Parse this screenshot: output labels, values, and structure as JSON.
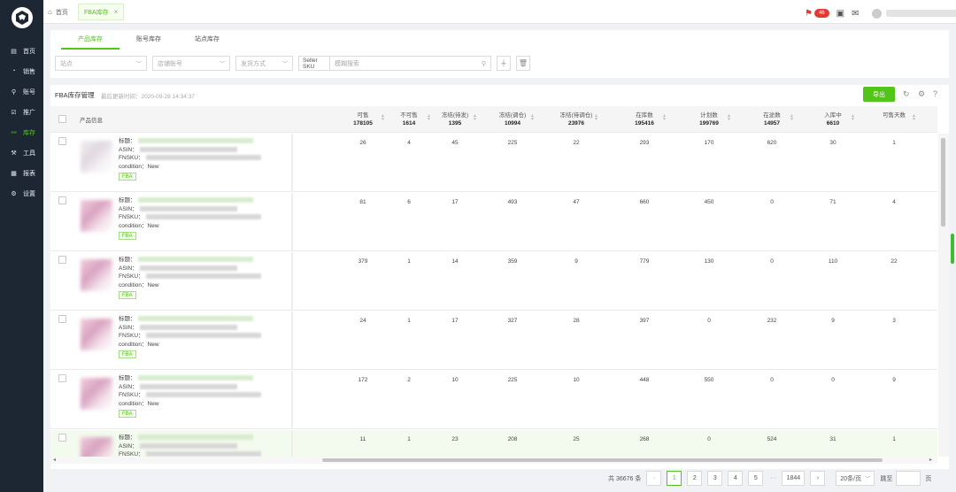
{
  "sidebar": {
    "items": [
      {
        "icon": "▤",
        "label": "首页"
      },
      {
        "icon": "◔",
        "label": "销售"
      },
      {
        "icon": "⚲",
        "label": "账号"
      },
      {
        "icon": "☑",
        "label": "推广"
      },
      {
        "icon": "⚯",
        "label": "库存",
        "active": true
      },
      {
        "icon": "⚒",
        "label": "工具"
      },
      {
        "icon": "▦",
        "label": "报表"
      },
      {
        "icon": "⚙",
        "label": "设置"
      }
    ]
  },
  "topbar": {
    "home_tab": "首页",
    "active_tab": "FBA库存",
    "notification_count": "46"
  },
  "subtabs": [
    "产品库存",
    "账号库存",
    "站点库存"
  ],
  "filters": {
    "site": "站点",
    "store": "店铺账号",
    "ship_method": "发货方式",
    "sku_type": "Seller SKU",
    "search_placeholder": "模糊搜索"
  },
  "panel": {
    "title": "FBA库存管理",
    "updated": "最后更新时间：2020-09-28 14:34:37",
    "export_label": "导出"
  },
  "table": {
    "info_header": "产品信息",
    "columns": [
      {
        "label": "可售",
        "total": "178105"
      },
      {
        "label": "不可售",
        "total": "1614"
      },
      {
        "label": "冻结(待发)",
        "total": "1395"
      },
      {
        "label": "冻结(调仓)",
        "total": "10994"
      },
      {
        "label": "冻结(待调仓)",
        "total": "23976"
      },
      {
        "label": "在库数",
        "total": "195416"
      },
      {
        "label": "计划数",
        "total": "199769"
      },
      {
        "label": "在途数",
        "total": "14957"
      },
      {
        "label": "入库中",
        "total": "6610"
      },
      {
        "label": "可售天数",
        "total": ""
      }
    ],
    "field_labels": {
      "title": "标题：",
      "asin": "ASIN：",
      "fnsku": "FNSKU：",
      "condition": "condition：New",
      "tag": "FBA"
    },
    "rows": [
      {
        "values": [
          "26",
          "4",
          "45",
          "225",
          "22",
          "293",
          "170",
          "620",
          "30",
          "1"
        ]
      },
      {
        "values": [
          "81",
          "6",
          "17",
          "493",
          "47",
          "660",
          "450",
          "0",
          "71",
          "4"
        ]
      },
      {
        "values": [
          "379",
          "1",
          "14",
          "359",
          "9",
          "779",
          "130",
          "0",
          "110",
          "22"
        ]
      },
      {
        "values": [
          "24",
          "1",
          "17",
          "327",
          "28",
          "397",
          "0",
          "232",
          "9",
          "3"
        ]
      },
      {
        "values": [
          "172",
          "2",
          "10",
          "225",
          "10",
          "448",
          "550",
          "0",
          "0",
          "9"
        ]
      },
      {
        "values": [
          "11",
          "1",
          "23",
          "208",
          "25",
          "268",
          "0",
          "524",
          "31",
          "1"
        ]
      }
    ]
  },
  "pagination": {
    "total": "共 36676 条",
    "pages": [
      "1",
      "2",
      "3",
      "4",
      "5"
    ],
    "ellipsis": "···",
    "last": "1844",
    "page_size": "20条/页",
    "jump_label": "跳至",
    "page_suffix": "页",
    "prev": "‹",
    "next": "›"
  }
}
